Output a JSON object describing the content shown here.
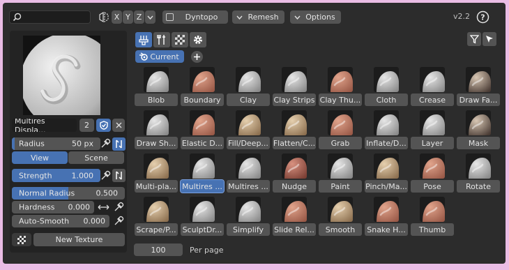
{
  "header": {
    "search_placeholder": "",
    "axes": [
      "X",
      "Y",
      "Z"
    ],
    "dyntopo_label": "Dyntopo",
    "remesh_label": "Remesh",
    "options_label": "Options",
    "version": "v2.2"
  },
  "brush": {
    "name": "Multires Displa...",
    "users": "2",
    "radius_label": "Radius",
    "radius_value": "50 px",
    "view_label": "View",
    "scene_label": "Scene",
    "strength_label": "Strength",
    "strength_value": "1.000",
    "strength_fraction": 1.0,
    "normal_radius_label": "Normal Radius",
    "normal_radius_value": "0.500",
    "normal_radius_fraction": 0.5,
    "hardness_label": "Hardness",
    "hardness_value": "0.000",
    "autosmooth_label": "Auto-Smooth",
    "autosmooth_value": "0.000",
    "new_texture_label": "New Texture"
  },
  "library": {
    "current_label": "Current",
    "per_page_value": "100",
    "per_page_label": "Per page",
    "tools": [
      {
        "label": "Blob",
        "style": "gray"
      },
      {
        "label": "Boundary",
        "style": "skin"
      },
      {
        "label": "Clay",
        "style": "gray"
      },
      {
        "label": "Clay Strips",
        "style": "gray"
      },
      {
        "label": "Clay Thu...",
        "style": "skin"
      },
      {
        "label": "Cloth",
        "style": "gray"
      },
      {
        "label": "Crease",
        "style": "gray"
      },
      {
        "label": "Draw Fa...",
        "style": "mixed"
      },
      {
        "label": "Draw Sh...",
        "style": "gray"
      },
      {
        "label": "Elastic D...",
        "style": "skin"
      },
      {
        "label": "Fill/Deep...",
        "style": "sand"
      },
      {
        "label": "Flatten/C...",
        "style": "sand"
      },
      {
        "label": "Grab",
        "style": "skin"
      },
      {
        "label": "Inflate/D...",
        "style": "gray"
      },
      {
        "label": "Layer",
        "style": "gray"
      },
      {
        "label": "Mask",
        "style": "mixed"
      },
      {
        "label": "Multi-pla...",
        "style": "sand"
      },
      {
        "label": "Multires ...",
        "style": "gray",
        "active": true
      },
      {
        "label": "Multires ...",
        "style": "gray"
      },
      {
        "label": "Nudge",
        "style": "rose"
      },
      {
        "label": "Paint",
        "style": "gray"
      },
      {
        "label": "Pinch/Ma...",
        "style": "sand"
      },
      {
        "label": "Pose",
        "style": "skin"
      },
      {
        "label": "Rotate",
        "style": "gray"
      },
      {
        "label": "Scrape/P...",
        "style": "sand"
      },
      {
        "label": "SculptDr...",
        "style": "gray"
      },
      {
        "label": "Simplify",
        "style": "gray"
      },
      {
        "label": "Slide Rel...",
        "style": "skin"
      },
      {
        "label": "Smooth",
        "style": "sand"
      },
      {
        "label": "Snake H...",
        "style": "skin"
      },
      {
        "label": "Thumb",
        "style": "skin"
      }
    ]
  },
  "colors": {
    "accent": "#4772b3",
    "panel": "#2c2c2c",
    "button": "#545454",
    "background": "#eabde5"
  },
  "icons": [
    "search-icon",
    "symmetry-icon",
    "chevron-down-icon",
    "help-icon",
    "brush-icon",
    "tools-icon",
    "checker-icon",
    "gear-icon",
    "filter-icon",
    "cursor-icon",
    "blender-icon",
    "plus-icon",
    "shield-icon",
    "close-icon",
    "eyedropper-icon",
    "pressure-icon",
    "arrows-icon"
  ]
}
